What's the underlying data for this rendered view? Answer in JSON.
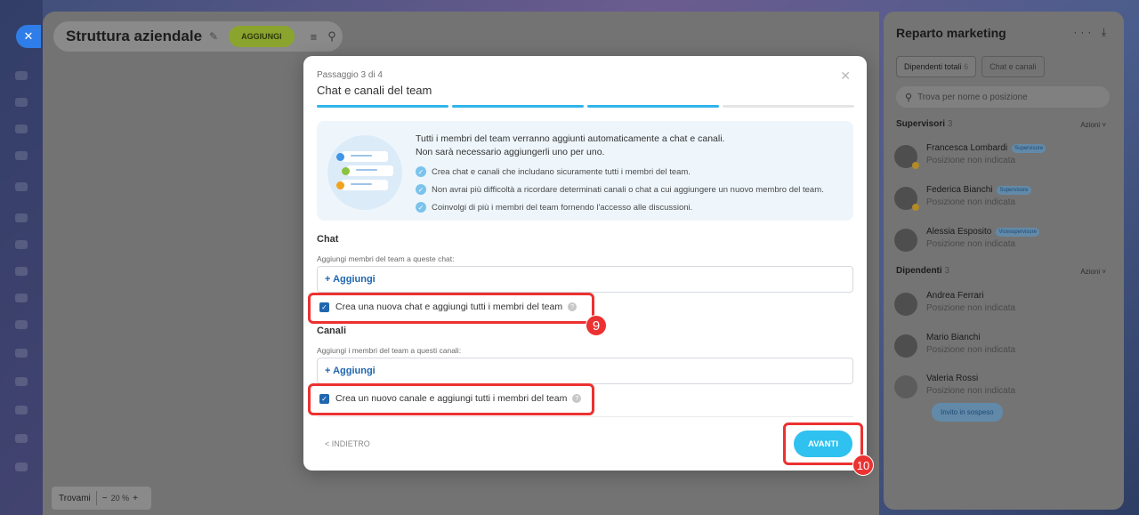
{
  "header": {
    "title": "Struttura aziendale",
    "add_label": "AGGIUNGI"
  },
  "zoom": {
    "find_label": "Trovami",
    "minus": "−",
    "value": "20",
    "unit": "%",
    "plus": "+"
  },
  "panel": {
    "title": "Reparto marketing",
    "more_glyph": "···",
    "collapse_glyph": "⤓",
    "tabs": [
      {
        "label": "Dipendenti totali",
        "count": "6"
      },
      {
        "label": "Chat e canali",
        "count": ""
      }
    ],
    "search_placeholder": "Trova per nome o posizione",
    "supervisors": {
      "label": "Supervisori",
      "count": "3",
      "actions": "Azioni ˅",
      "people": [
        {
          "name": "Francesca Lombardi",
          "role": "Supervisore",
          "position": "Posizione non indicata"
        },
        {
          "name": "Federica Bianchi",
          "role": "Supervisore",
          "position": "Posizione non indicata"
        },
        {
          "name": "Alessia Esposito",
          "role": "Vicesupervisore",
          "position": "Posizione non indicata"
        }
      ]
    },
    "employees": {
      "label": "Dipendenti",
      "count": "3",
      "actions": "Azioni ˅",
      "people": [
        {
          "name": "Andrea Ferrari",
          "position": "Posizione non indicata"
        },
        {
          "name": "Mario Bianchi",
          "position": "Posizione non indicata"
        },
        {
          "name": "Valeria Rossi",
          "position": "Posizione non indicata"
        }
      ],
      "invite_label": "Invito in sospeso"
    }
  },
  "modal": {
    "step": "Passaggio 3 di 4",
    "title": "Chat e canali del team",
    "progress": {
      "current": 3,
      "total": 4
    },
    "info": {
      "lead": "Tutti i membri del team verranno aggiunti automaticamente a chat e canali.",
      "lead2": "Non sarà necessario aggiungerli uno per uno.",
      "bullets": [
        "Crea chat e canali che includano sicuramente tutti i membri del team.",
        "Non avrai più difficoltà a ricordare determinati canali o chat a cui aggiungere un nuovo membro del team.",
        "Coinvolgi di più i membri del team fornendo l'accesso alle discussioni."
      ]
    },
    "chat": {
      "title": "Chat",
      "hint": "Aggiungi membri del team a queste chat:",
      "add_label": "+ Aggiungi",
      "checkbox_label": "Crea una nuova chat e aggiungi tutti i membri del team",
      "checked": true
    },
    "channels": {
      "title": "Canali",
      "hint": "Aggiungi i membri del team a questi canali:",
      "add_label": "+ Aggiungi",
      "checkbox_label": "Crea un nuovo canale e aggiungi tutti i membri del team",
      "checked": true
    },
    "back_label": "< INDIETRO",
    "next_label": "AVANTI"
  },
  "annotations": {
    "badge_9": "9",
    "badge_10": "10"
  },
  "colors": {
    "accent": "#2fc1ef",
    "link": "#2066b0",
    "highlight": "#ec3131"
  }
}
